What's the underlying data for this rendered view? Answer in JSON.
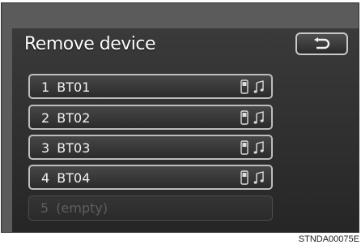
{
  "screen": {
    "title": "Remove device",
    "devices": [
      {
        "label": "1  BT01"
      },
      {
        "label": "2  BT02"
      },
      {
        "label": "3  BT03"
      },
      {
        "label": "4  BT04"
      }
    ],
    "empty_slot": {
      "label": "5  (empty)"
    },
    "icons": [
      "phone-icon",
      "music-note-icon"
    ],
    "back_icon": "back-arrow-icon"
  },
  "caption": "STNDA00075E"
}
